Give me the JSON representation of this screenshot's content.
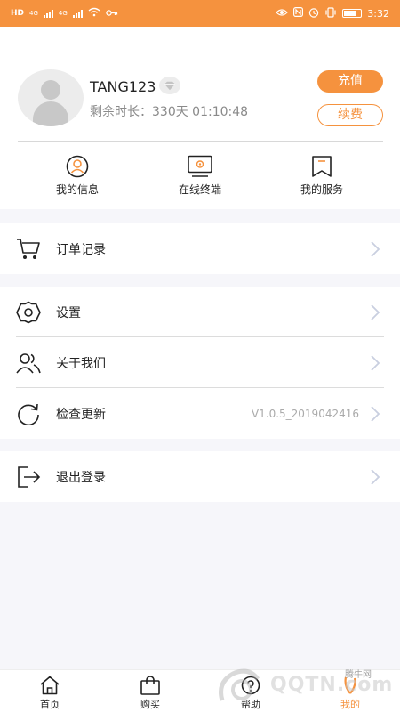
{
  "status_bar": {
    "network": "HD",
    "signal1": "4G",
    "signal2": "4G",
    "time": "3:32"
  },
  "profile": {
    "username": "TANG123",
    "remaining_label": "剩余时长：330天 01:10:48",
    "recharge_label": "充值",
    "renew_label": "续费"
  },
  "quick_actions": [
    {
      "label": "我的信息",
      "icon": "user-circle-icon"
    },
    {
      "label": "在线终端",
      "icon": "monitor-gear-icon"
    },
    {
      "label": "我的服务",
      "icon": "bookmark-icon"
    }
  ],
  "menu": {
    "orders": {
      "label": "订单记录",
      "icon": "cart-icon"
    },
    "settings": {
      "label": "设置",
      "icon": "gear-icon"
    },
    "about": {
      "label": "关于我们",
      "icon": "users-icon"
    },
    "update": {
      "label": "检查更新",
      "icon": "refresh-icon",
      "version": "V1.0.5_2019042416"
    },
    "logout": {
      "label": "退出登录",
      "icon": "logout-icon"
    }
  },
  "tabs": [
    {
      "label": "首页",
      "icon": "home-icon",
      "active": false
    },
    {
      "label": "购买",
      "icon": "bag-icon",
      "active": false
    },
    {
      "label": "帮助",
      "icon": "help-icon",
      "active": false
    },
    {
      "label": "我的",
      "icon": "me-icon",
      "active": true
    }
  ],
  "colors": {
    "accent": "#f5923e",
    "background": "#f6f6fa"
  },
  "watermark": {
    "text": "QQTN.com",
    "sub": "腾牛网"
  }
}
